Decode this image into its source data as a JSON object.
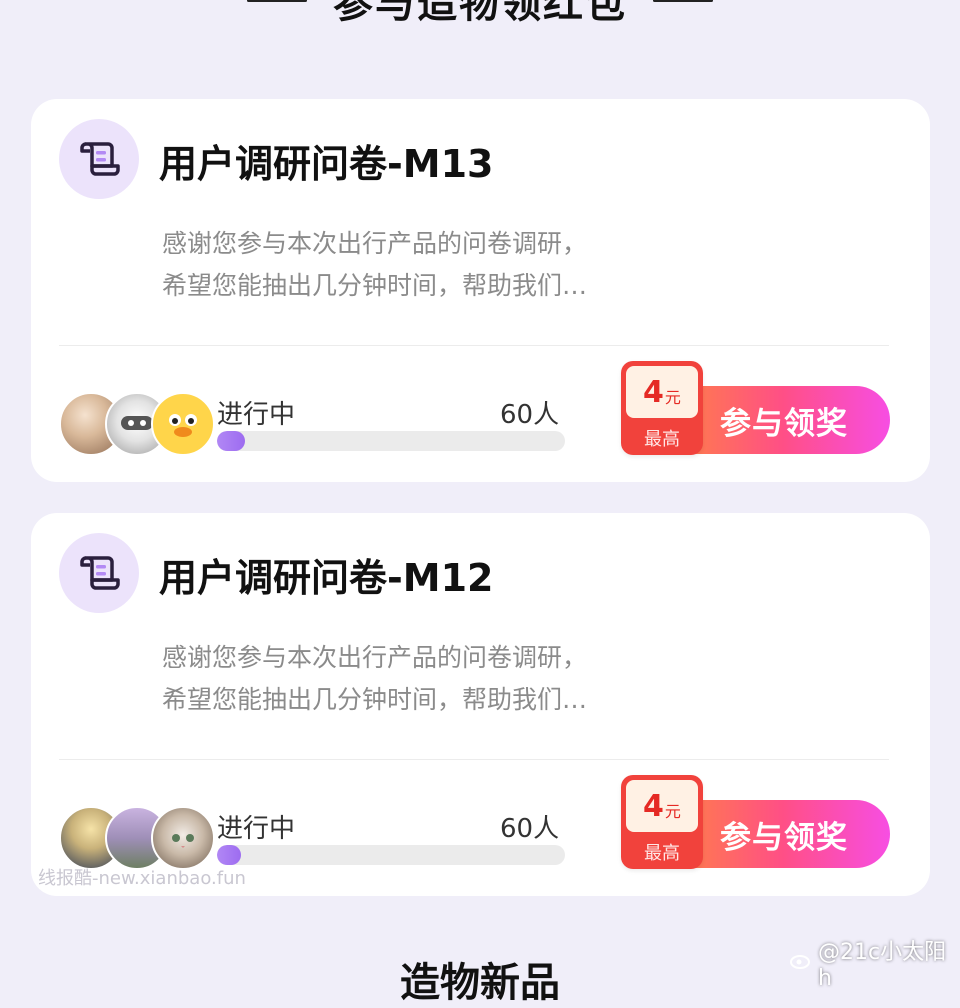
{
  "section": {
    "title": "参与造物领红包"
  },
  "cards": [
    {
      "title": "用户调研问卷-M13",
      "desc_line1": "感谢您参与本次出行产品的问卷调研，",
      "desc_line2": "希望您能抽出几分钟时间，帮助我们…",
      "status": "进行中",
      "count": "60人",
      "progress": 0.08,
      "reward_amount": "4",
      "reward_unit": "元",
      "reward_caption": "最高",
      "button_label": "参与领奖",
      "icon": "scroll-document-icon"
    },
    {
      "title": "用户调研问卷-M12",
      "desc_line1": "感谢您参与本次出行产品的问卷调研，",
      "desc_line2": "希望您能抽出几分钟时间，帮助我们…",
      "status": "进行中",
      "count": "60人",
      "progress": 0.07,
      "reward_amount": "4",
      "reward_unit": "元",
      "reward_caption": "最高",
      "button_label": "参与领奖",
      "icon": "scroll-document-icon"
    }
  ],
  "watermark": "线报酷-new.xianbao.fun",
  "credit": "@21c小太阳h",
  "next_section_title": "造物新品",
  "colors": {
    "accent_purple": "#9d6cf0",
    "button_gradient_start": "#ff8a3a",
    "button_gradient_end": "#f74ee3",
    "reward_red": "#f1423c"
  }
}
